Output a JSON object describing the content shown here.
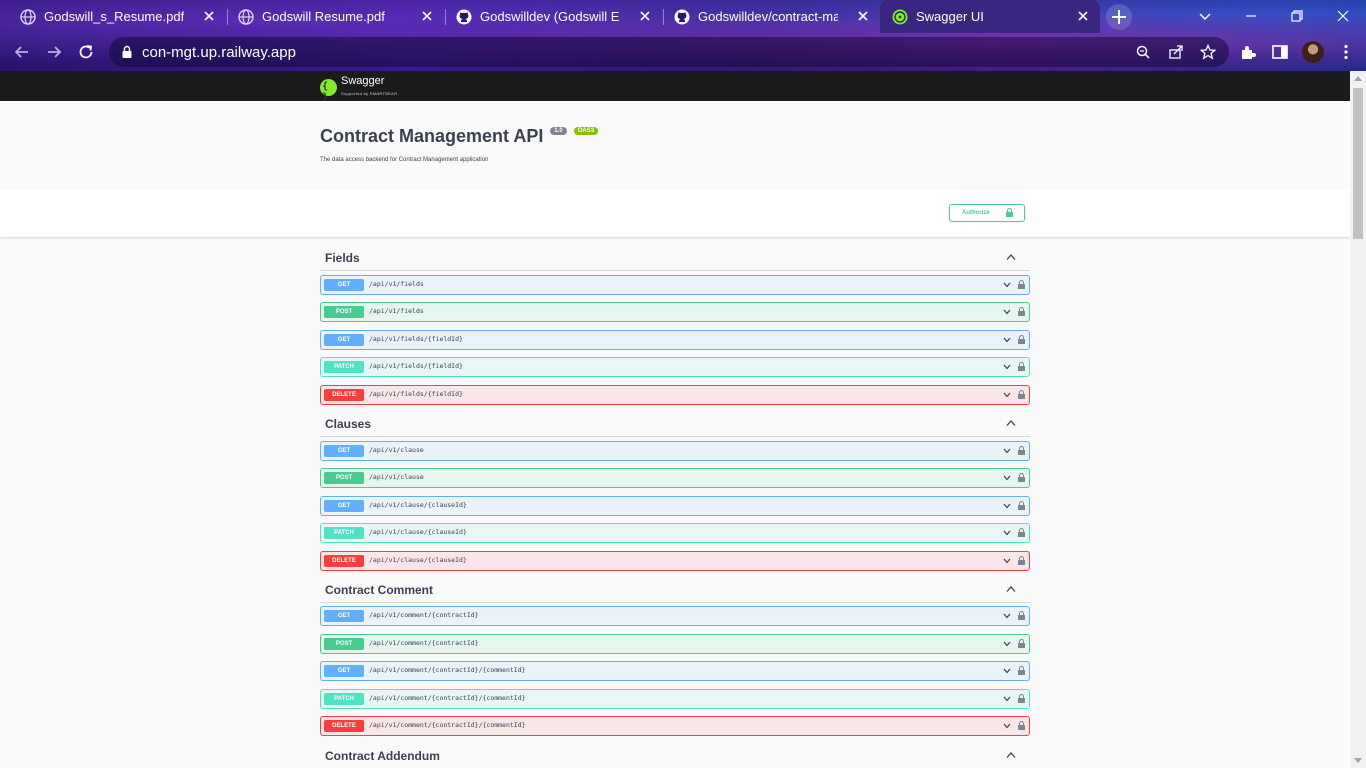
{
  "browser": {
    "tabs": [
      {
        "title": "Godswill_s_Resume.pdf",
        "icon": "globe-icon"
      },
      {
        "title": "Godswill Resume.pdf",
        "icon": "globe-icon"
      },
      {
        "title": "Godswilldev (Godswill Edet)",
        "icon": "github-icon"
      },
      {
        "title": "Godswilldev/contract-manag",
        "icon": "github-icon"
      },
      {
        "title": "Swagger UI",
        "icon": "swagger-icon",
        "active": true
      }
    ],
    "url": "con-mgt.up.railway.app"
  },
  "swagger": {
    "logo_text": "Swagger",
    "logo_sub": "Supported by SMARTBEAR",
    "title": "Contract Management API",
    "version": "1.0",
    "oas": "OAS3",
    "description": "The data access backend for Contract Management application",
    "authorize_label": "Authorize"
  },
  "sections": [
    {
      "name": "Fields",
      "ops": [
        {
          "method": "GET",
          "path": "/api/v1/fields"
        },
        {
          "method": "POST",
          "path": "/api/v1/fields"
        },
        {
          "method": "GET",
          "path": "/api/v1/fields/{fieldId}"
        },
        {
          "method": "PATCH",
          "path": "/api/v1/fields/{fieldId}"
        },
        {
          "method": "DELETE",
          "path": "/api/v1/fields/{fieldId}"
        }
      ]
    },
    {
      "name": "Clauses",
      "ops": [
        {
          "method": "GET",
          "path": "/api/v1/clause"
        },
        {
          "method": "POST",
          "path": "/api/v1/clause"
        },
        {
          "method": "GET",
          "path": "/api/v1/clause/{clauseId}"
        },
        {
          "method": "PATCH",
          "path": "/api/v1/clause/{clauseId}"
        },
        {
          "method": "DELETE",
          "path": "/api/v1/clause/{clauseId}"
        }
      ]
    },
    {
      "name": "Contract Comment",
      "ops": [
        {
          "method": "GET",
          "path": "/api/v1/comment/{contractId}"
        },
        {
          "method": "POST",
          "path": "/api/v1/comment/{contractId}"
        },
        {
          "method": "GET",
          "path": "/api/v1/comment/{contractId}/{commentId}"
        },
        {
          "method": "PATCH",
          "path": "/api/v1/comment/{contractId}/{commentId}"
        },
        {
          "method": "DELETE",
          "path": "/api/v1/comment/{contractId}/{commentId}"
        }
      ]
    },
    {
      "name": "Contract Addendum",
      "ops": []
    }
  ],
  "colors": {
    "get": "#61affe",
    "post": "#49cc90",
    "patch": "#50e3c2",
    "delete": "#f93e3e",
    "text": "#3b4151"
  }
}
